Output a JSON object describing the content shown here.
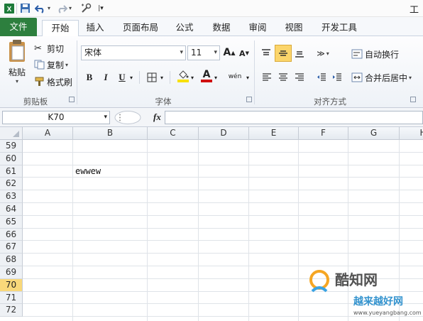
{
  "title_fragment": "工",
  "quick_access": {
    "icons": [
      "excel-icon",
      "save-icon",
      "undo-icon",
      "redo-icon",
      "customize-icon"
    ]
  },
  "tabs": [
    {
      "label": "文件"
    },
    {
      "label": "开始"
    },
    {
      "label": "插入"
    },
    {
      "label": "页面布局"
    },
    {
      "label": "公式"
    },
    {
      "label": "数据"
    },
    {
      "label": "审阅"
    },
    {
      "label": "视图"
    },
    {
      "label": "开发工具"
    }
  ],
  "clipboard": {
    "paste": "粘贴",
    "cut": "剪切",
    "copy": "复制",
    "format_painter": "格式刷",
    "group_label": "剪贴板"
  },
  "font": {
    "name": "宋体",
    "size": "11",
    "bold": "B",
    "italic": "I",
    "underline": "U",
    "grow": "A",
    "shrink": "A",
    "font_color_letter": "A",
    "phonetic": "wén",
    "group_label": "字体"
  },
  "alignment": {
    "wrap_text": "自动换行",
    "merge_center": "合并后居中",
    "group_label": "对齐方式"
  },
  "formula_bar": {
    "name_box": "K70",
    "fx": "fx",
    "formula": ""
  },
  "grid": {
    "columns": [
      "A",
      "B",
      "C",
      "D",
      "E",
      "F",
      "G",
      "H"
    ],
    "rows": [
      "59",
      "60",
      "61",
      "62",
      "63",
      "64",
      "65",
      "66",
      "67",
      "68",
      "69",
      "70",
      "71",
      "72"
    ],
    "active_row": "70",
    "cells": {
      "B61": "ewwew"
    }
  },
  "watermark": {
    "line1": "酷知网",
    "line2": "越来越好网",
    "url": "www.yueyangbang.com"
  },
  "colors": {
    "file_tab": "#2d7f3e",
    "active_row_header": "#f9d87a",
    "font_color_bar": "#d01010",
    "fill_color_bar": "#f8e000"
  }
}
